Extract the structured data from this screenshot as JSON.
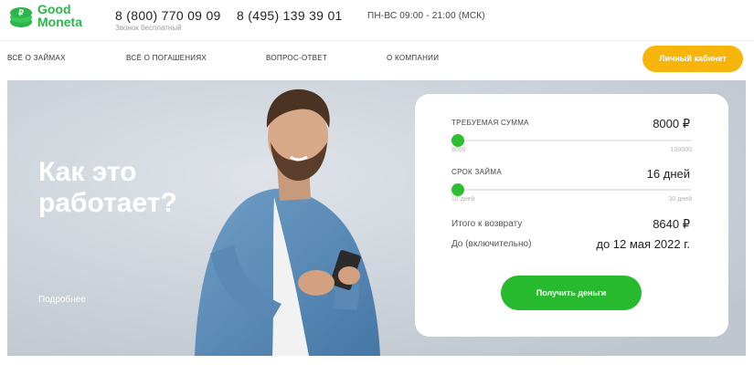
{
  "brand": {
    "line1": "Good",
    "line2": "Moneta",
    "color": "#2db54b"
  },
  "contacts": {
    "phone1": "8 (800) 770 09 09",
    "phone1_note": "Звонок бесплатный",
    "phone2": "8 (495) 139 39 01",
    "hours": "ПН-ВС 09:00 - 21:00 (МСК)"
  },
  "nav": {
    "items": [
      {
        "label": "ВСЁ О ЗАЙМАХ"
      },
      {
        "label": "ВСЁ О ПОГАШЕНИЯХ"
      },
      {
        "label": "ВОПРОС-ОТВЕТ"
      },
      {
        "label": "О КОМПАНИИ"
      }
    ],
    "cabinet_label": "Личный кабинет"
  },
  "hero": {
    "title_line1": "Как это",
    "title_line2": "работает?",
    "more_label": "Подробнее"
  },
  "calculator": {
    "amount": {
      "label": "ТРЕБУЕМАЯ СУММА",
      "value": "8000 ₽",
      "min": "8000",
      "max": "100000",
      "current": 8000,
      "range_min": 8000,
      "range_max": 100000
    },
    "term": {
      "label": "СРОК ЗАЙМА",
      "value": "16 дней",
      "min": "16 дней",
      "max": "30 дней",
      "current": 16,
      "range_min": 16,
      "range_max": 30
    },
    "total_label": "Итого к возврату",
    "total_value": "8640 ₽",
    "until_label": "До (включительно)",
    "until_value": "до 12 мая 2022 г.",
    "submit_label": "Получить деньги"
  },
  "colors": {
    "accent_green": "#2dbf2f",
    "accent_yellow": "#f7b40a",
    "hero_bg": "#c9d0d9"
  }
}
